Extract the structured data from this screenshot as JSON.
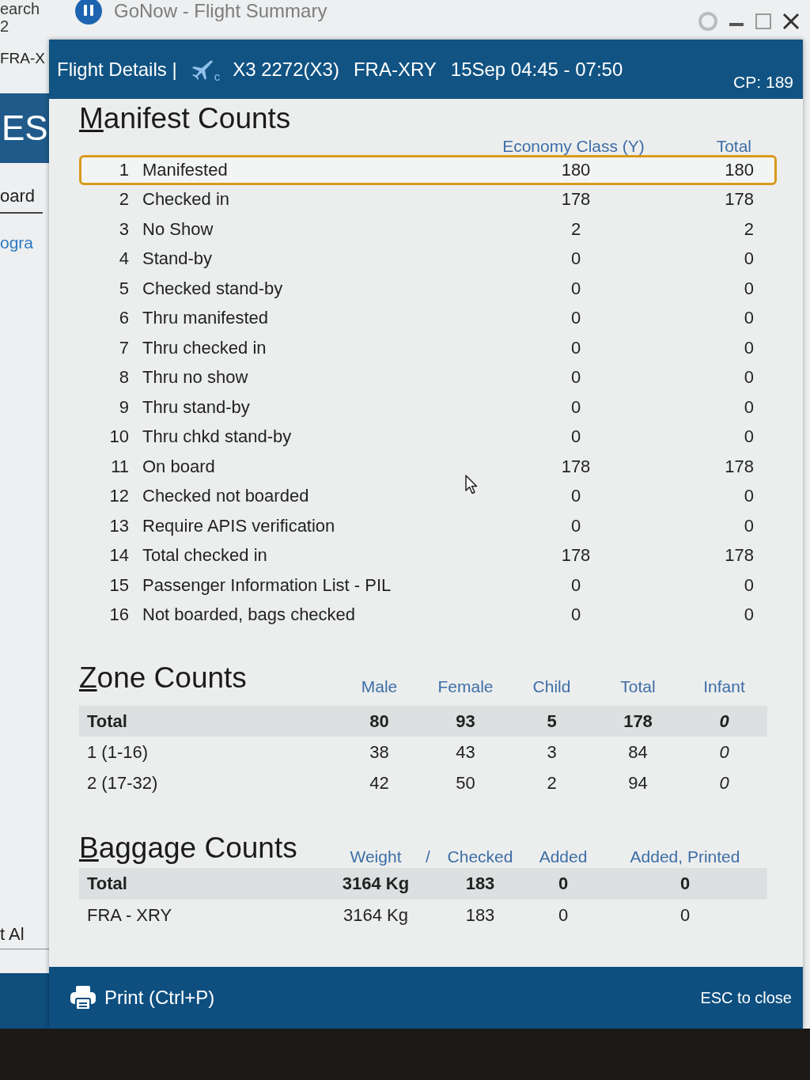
{
  "background_window": {
    "title": "GoNow - Flight Summary",
    "search_label": "earch",
    "search_count": "2",
    "route_tab": "FRA-X",
    "logo_text": "ES",
    "menu_item": "oard",
    "link": "ogra",
    "bottom_text": "t Al"
  },
  "dialog": {
    "title": "Flight Details |",
    "flight_status": "c",
    "flight": "X3 2272(X3)",
    "route": "FRA-XRY",
    "schedule": "15Sep 04:45 - 07:50",
    "cp": "CP: 189"
  },
  "manifest_counts": {
    "title": "Manifest Counts",
    "columns": [
      "Economy Class (Y)",
      "Total"
    ],
    "rows": [
      {
        "number": "1",
        "label": "Manifested",
        "values": [
          "180",
          "180"
        ],
        "selected": true
      },
      {
        "number": "2",
        "label": "Checked in",
        "values": [
          "178",
          "178"
        ],
        "selected": false
      },
      {
        "number": "3",
        "label": "No Show",
        "values": [
          "2",
          "2"
        ],
        "selected": false
      },
      {
        "number": "4",
        "label": "Stand-by",
        "values": [
          "0",
          "0"
        ],
        "selected": false
      },
      {
        "number": "5",
        "label": "Checked stand-by",
        "values": [
          "0",
          "0"
        ],
        "selected": false
      },
      {
        "number": "6",
        "label": "Thru manifested",
        "values": [
          "0",
          "0"
        ],
        "selected": false
      },
      {
        "number": "7",
        "label": "Thru checked in",
        "values": [
          "0",
          "0"
        ],
        "selected": false
      },
      {
        "number": "8",
        "label": "Thru no show",
        "values": [
          "0",
          "0"
        ],
        "selected": false
      },
      {
        "number": "9",
        "label": "Thru stand-by",
        "values": [
          "0",
          "0"
        ],
        "selected": false
      },
      {
        "number": "10",
        "label": "Thru chkd stand-by",
        "values": [
          "0",
          "0"
        ],
        "selected": false
      },
      {
        "number": "11",
        "label": "On board",
        "values": [
          "178",
          "178"
        ],
        "selected": false
      },
      {
        "number": "12",
        "label": "Checked not boarded",
        "values": [
          "0",
          "0"
        ],
        "selected": false
      },
      {
        "number": "13",
        "label": "Require APIS verification",
        "values": [
          "0",
          "0"
        ],
        "selected": false
      },
      {
        "number": "14",
        "label": "Total checked in",
        "values": [
          "178",
          "178"
        ],
        "selected": false
      },
      {
        "number": "15",
        "label": "Passenger Information List - PIL",
        "values": [
          "0",
          "0"
        ],
        "selected": false
      },
      {
        "number": "16",
        "label": "Not boarded, bags checked",
        "values": [
          "0",
          "0"
        ],
        "selected": false
      }
    ]
  },
  "zone_counts": {
    "title": "Zone Counts",
    "columns": [
      "Male",
      "Female",
      "Child",
      "Total",
      "Infant"
    ],
    "rows": [
      {
        "kind": "total",
        "label": "Total",
        "values": [
          "80",
          "93",
          "5",
          "178",
          "0"
        ]
      },
      {
        "kind": "zone",
        "label": "1 (1-16)",
        "values": [
          "38",
          "43",
          "3",
          "84",
          "0"
        ]
      },
      {
        "kind": "zone",
        "label": "2 (17-32)",
        "values": [
          "42",
          "50",
          "2",
          "94",
          "0"
        ]
      }
    ]
  },
  "baggage_counts": {
    "title": "Baggage Counts",
    "columns": [
      "Weight",
      "Checked",
      "Added",
      "Added, Printed"
    ],
    "column_separator": "/",
    "rows": [
      {
        "kind": "total",
        "label": "Total",
        "values": [
          "3164 Kg",
          "183",
          "0",
          "0"
        ]
      },
      {
        "kind": "route",
        "label": "FRA - XRY",
        "values": [
          "3164 Kg",
          "183",
          "0",
          "0"
        ]
      }
    ]
  },
  "footer": {
    "print_button": "Print (Ctrl+P)",
    "close_hint": "ESC to close"
  }
}
